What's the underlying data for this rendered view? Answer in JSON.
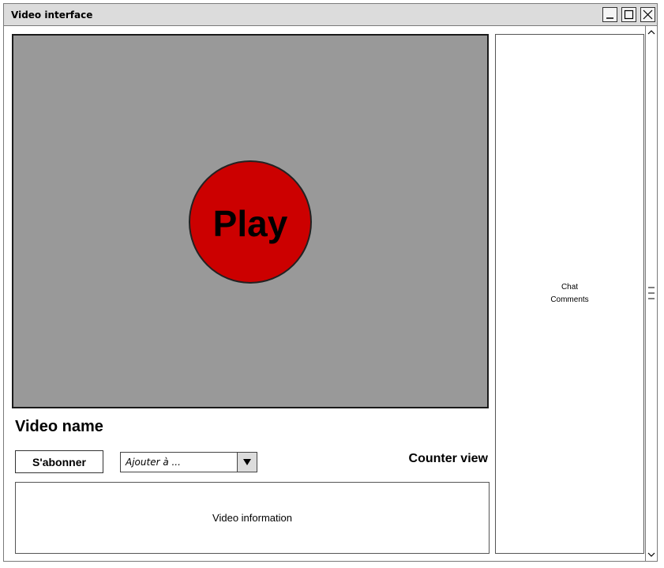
{
  "window": {
    "title": "Video interface",
    "controls": {
      "minimize": "minimize-icon",
      "maximize": "maximize-icon",
      "close": "close-icon"
    }
  },
  "player": {
    "play_label": "Play",
    "background_color": "#999999",
    "play_color": "#cc0000"
  },
  "video": {
    "name": "Video name",
    "counter": "Counter view",
    "information": "Video information"
  },
  "actions": {
    "subscribe_label": "S'abonner",
    "add_to": {
      "selected": "Ajouter à ...",
      "arrow_icon": "triangle-down-icon"
    }
  },
  "side_panel": {
    "line1": "Chat",
    "line2": "Comments"
  },
  "scrollbar": {
    "up_icon": "chevron-up-icon",
    "down_icon": "chevron-down-icon"
  }
}
